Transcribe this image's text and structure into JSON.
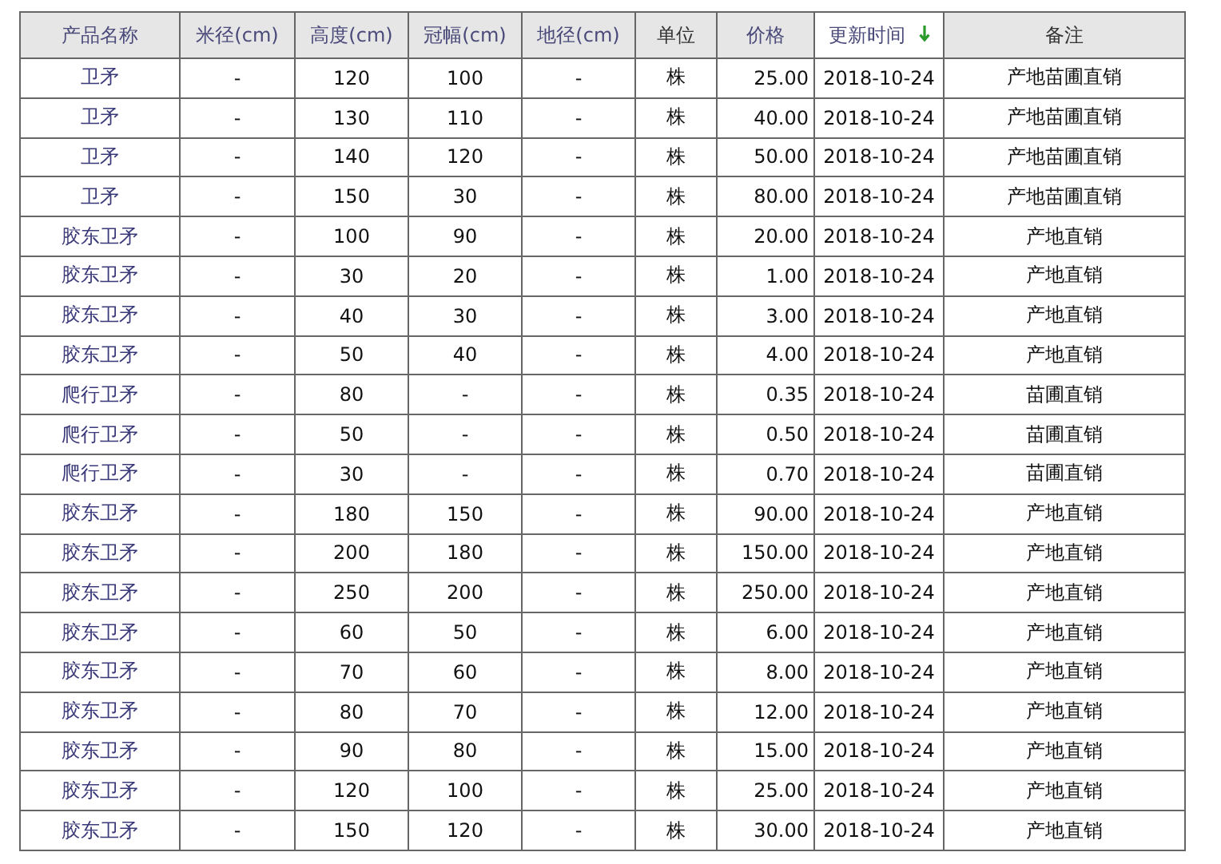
{
  "table": {
    "columns": [
      {
        "label": "产品名称",
        "kind": "sortable",
        "sorted": false
      },
      {
        "label": "米径(cm)",
        "kind": "sortable",
        "sorted": false
      },
      {
        "label": "高度(cm)",
        "kind": "sortable",
        "sorted": false
      },
      {
        "label": "冠幅(cm)",
        "kind": "sortable",
        "sorted": false
      },
      {
        "label": "地径(cm)",
        "kind": "sortable",
        "sorted": false
      },
      {
        "label": "单位",
        "kind": "plain",
        "sorted": false
      },
      {
        "label": "价格",
        "kind": "sortable",
        "sorted": false
      },
      {
        "label": "更新时间",
        "kind": "sortable",
        "sorted": true
      },
      {
        "label": "备注",
        "kind": "plain",
        "sorted": false
      }
    ],
    "rows": [
      [
        "卫矛",
        "-",
        "120",
        "100",
        "-",
        "株",
        "25.00",
        "2018-10-24",
        "产地苗圃直销"
      ],
      [
        "卫矛",
        "-",
        "130",
        "110",
        "-",
        "株",
        "40.00",
        "2018-10-24",
        "产地苗圃直销"
      ],
      [
        "卫矛",
        "-",
        "140",
        "120",
        "-",
        "株",
        "50.00",
        "2018-10-24",
        "产地苗圃直销"
      ],
      [
        "卫矛",
        "-",
        "150",
        "30",
        "-",
        "株",
        "80.00",
        "2018-10-24",
        "产地苗圃直销"
      ],
      [
        "胶东卫矛",
        "-",
        "100",
        "90",
        "-",
        "株",
        "20.00",
        "2018-10-24",
        "产地直销"
      ],
      [
        "胶东卫矛",
        "-",
        "30",
        "20",
        "-",
        "株",
        "1.00",
        "2018-10-24",
        "产地直销"
      ],
      [
        "胶东卫矛",
        "-",
        "40",
        "30",
        "-",
        "株",
        "3.00",
        "2018-10-24",
        "产地直销"
      ],
      [
        "胶东卫矛",
        "-",
        "50",
        "40",
        "-",
        "株",
        "4.00",
        "2018-10-24",
        "产地直销"
      ],
      [
        "爬行卫矛",
        "-",
        "80",
        "-",
        "-",
        "株",
        "0.35",
        "2018-10-24",
        "苗圃直销"
      ],
      [
        "爬行卫矛",
        "-",
        "50",
        "-",
        "-",
        "株",
        "0.50",
        "2018-10-24",
        "苗圃直销"
      ],
      [
        "爬行卫矛",
        "-",
        "30",
        "-",
        "-",
        "株",
        "0.70",
        "2018-10-24",
        "苗圃直销"
      ],
      [
        "胶东卫矛",
        "-",
        "180",
        "150",
        "-",
        "株",
        "90.00",
        "2018-10-24",
        "产地直销"
      ],
      [
        "胶东卫矛",
        "-",
        "200",
        "180",
        "-",
        "株",
        "150.00",
        "2018-10-24",
        "产地直销"
      ],
      [
        "胶东卫矛",
        "-",
        "250",
        "200",
        "-",
        "株",
        "250.00",
        "2018-10-24",
        "产地直销"
      ],
      [
        "胶东卫矛",
        "-",
        "60",
        "50",
        "-",
        "株",
        "6.00",
        "2018-10-24",
        "产地直销"
      ],
      [
        "胶东卫矛",
        "-",
        "70",
        "60",
        "-",
        "株",
        "8.00",
        "2018-10-24",
        "产地直销"
      ],
      [
        "胶东卫矛",
        "-",
        "80",
        "70",
        "-",
        "株",
        "12.00",
        "2018-10-24",
        "产地直销"
      ],
      [
        "胶东卫矛",
        "-",
        "90",
        "80",
        "-",
        "株",
        "15.00",
        "2018-10-24",
        "产地直销"
      ],
      [
        "胶东卫矛",
        "-",
        "120",
        "100",
        "-",
        "株",
        "25.00",
        "2018-10-24",
        "产地直销"
      ],
      [
        "胶东卫矛",
        "-",
        "150",
        "120",
        "-",
        "株",
        "30.00",
        "2018-10-24",
        "产地直销"
      ]
    ]
  }
}
